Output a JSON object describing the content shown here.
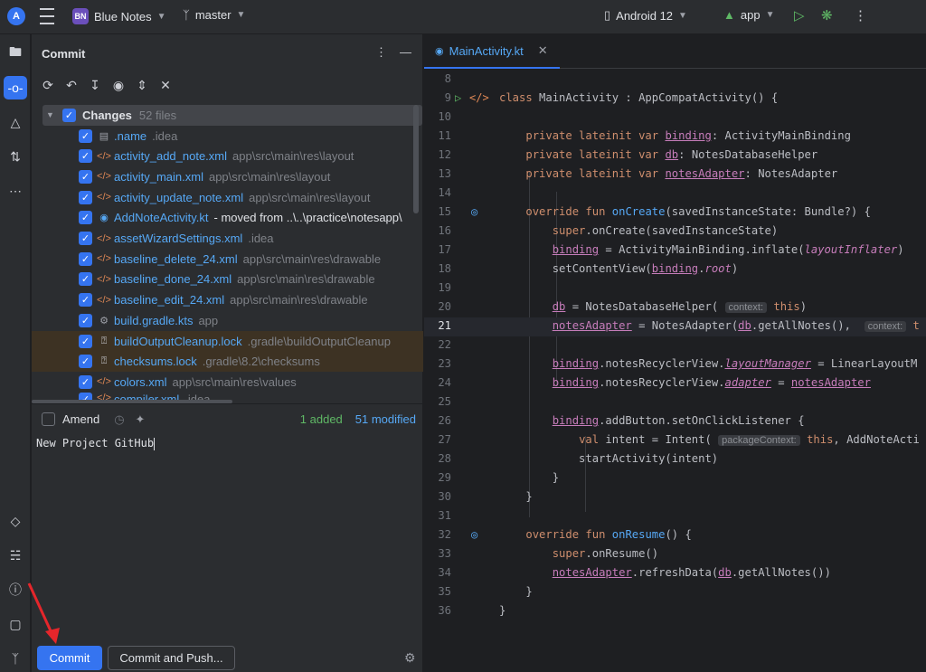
{
  "topbar": {
    "logo": "A",
    "project_badge": "BN",
    "project_name": "Blue Notes",
    "branch": "master",
    "device": "Android 12",
    "run_config": "app"
  },
  "panel": {
    "title": "Commit",
    "changes_label": "Changes",
    "changes_count": "52 files",
    "files": [
      {
        "name": ".name",
        "path": ".idea",
        "icon": "file-icon"
      },
      {
        "name": "activity_add_note.xml",
        "path": "app\\src\\main\\res\\layout",
        "icon": "xml-icon"
      },
      {
        "name": "activity_main.xml",
        "path": "app\\src\\main\\res\\layout",
        "icon": "xml-icon"
      },
      {
        "name": "activity_update_note.xml",
        "path": "app\\src\\main\\res\\layout",
        "icon": "xml-icon"
      },
      {
        "name": "AddNoteActivity.kt",
        "extra": "- moved from ..\\..\\practice\\notesapp\\",
        "icon": "kotlin-class-icon"
      },
      {
        "name": "assetWizardSettings.xml",
        "path": ".idea",
        "icon": "xml-icon"
      },
      {
        "name": "baseline_delete_24.xml",
        "path": "app\\src\\main\\res\\drawable",
        "icon": "xml-icon"
      },
      {
        "name": "baseline_done_24.xml",
        "path": "app\\src\\main\\res\\drawable",
        "icon": "xml-icon"
      },
      {
        "name": "baseline_edit_24.xml",
        "path": "app\\src\\main\\res\\drawable",
        "icon": "xml-icon"
      },
      {
        "name": "build.gradle.kts",
        "path": "app",
        "icon": "gradle-icon"
      },
      {
        "name": "buildOutputCleanup.lock",
        "path": ".gradle\\buildOutputCleanup",
        "icon": "unknown-file-icon"
      },
      {
        "name": "checksums.lock",
        "path": ".gradle\\8.2\\checksums",
        "icon": "unknown-file-icon"
      },
      {
        "name": "colors.xml",
        "path": "app\\src\\main\\res\\values",
        "icon": "xml-icon"
      },
      {
        "name": "compiler.xml",
        "path": ".idea",
        "icon": "xml-icon"
      }
    ],
    "amend_label": "Amend",
    "added": "1 added",
    "modified": "51 modified",
    "commit_message": "New Project GitHub",
    "commit_button": "Commit",
    "commit_push_button": "Commit and Push..."
  },
  "editor": {
    "tab_name": "MainActivity.kt",
    "lines": [
      {
        "n": "8"
      },
      {
        "n": "9"
      },
      {
        "n": "10"
      },
      {
        "n": "11"
      },
      {
        "n": "12"
      },
      {
        "n": "13"
      },
      {
        "n": "14"
      },
      {
        "n": "15"
      },
      {
        "n": "16"
      },
      {
        "n": "17"
      },
      {
        "n": "18"
      },
      {
        "n": "19"
      },
      {
        "n": "20"
      },
      {
        "n": "21"
      },
      {
        "n": "22"
      },
      {
        "n": "23"
      },
      {
        "n": "24"
      },
      {
        "n": "25"
      },
      {
        "n": "26"
      },
      {
        "n": "27"
      },
      {
        "n": "28"
      },
      {
        "n": "29"
      },
      {
        "n": "30"
      },
      {
        "n": "31"
      },
      {
        "n": "32"
      },
      {
        "n": "33"
      },
      {
        "n": "34"
      },
      {
        "n": "35"
      },
      {
        "n": "36"
      }
    ],
    "hint_context": "context:",
    "hint_package_context": "packageContext:"
  },
  "colors": {
    "accent": "#3574f0",
    "added": "#5fb865",
    "modified": "#56a8f5"
  }
}
